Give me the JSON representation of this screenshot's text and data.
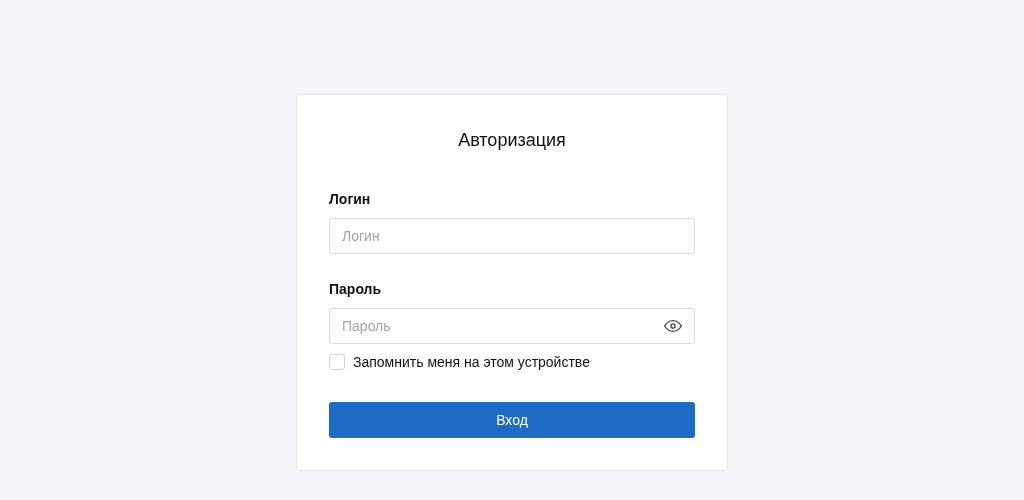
{
  "card": {
    "title": "Авторизация"
  },
  "fields": [
    {
      "label": "Логин",
      "placeholder": "Логин",
      "kind": "text"
    },
    {
      "label": "Пароль",
      "placeholder": "Пароль",
      "kind": "password"
    }
  ],
  "remember": {
    "label": "Запомнить меня на этом устройстве",
    "checked": false
  },
  "submit": {
    "label": "Вход"
  }
}
